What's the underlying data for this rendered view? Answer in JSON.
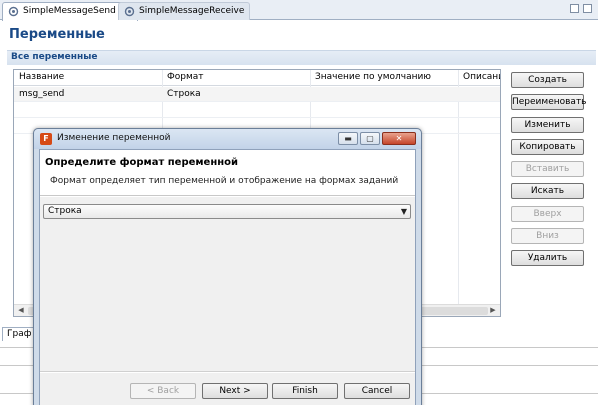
{
  "tabs": [
    {
      "label": "SimpleMessageSend",
      "active": true,
      "close": "⊠"
    },
    {
      "label": "SimpleMessageReceive",
      "active": false
    }
  ],
  "page": {
    "title": "Переменные",
    "section": "Все переменные"
  },
  "table": {
    "headers": [
      "Название",
      "Формат",
      "Значение по умолчанию",
      "Описание"
    ],
    "rows": [
      [
        "msg_send",
        "Строка",
        "",
        ""
      ]
    ]
  },
  "buttons": {
    "create": "Создать",
    "rename": "Переименовать",
    "edit": "Изменить",
    "copy": "Копировать",
    "paste": "Вставить",
    "search": "Искать",
    "up": "Вверх",
    "down": "Вниз",
    "delete": "Удалить"
  },
  "bottom_tab": "Граф",
  "dialog": {
    "title": "Изменение переменной",
    "icon_letter": "F",
    "header_title": "Определите формат переменной",
    "header_desc": "Формат определяет тип переменной и отображение на формах заданий",
    "format_value": "Строка",
    "back": "< Back",
    "next": "Next >",
    "finish": "Finish",
    "cancel": "Cancel"
  }
}
